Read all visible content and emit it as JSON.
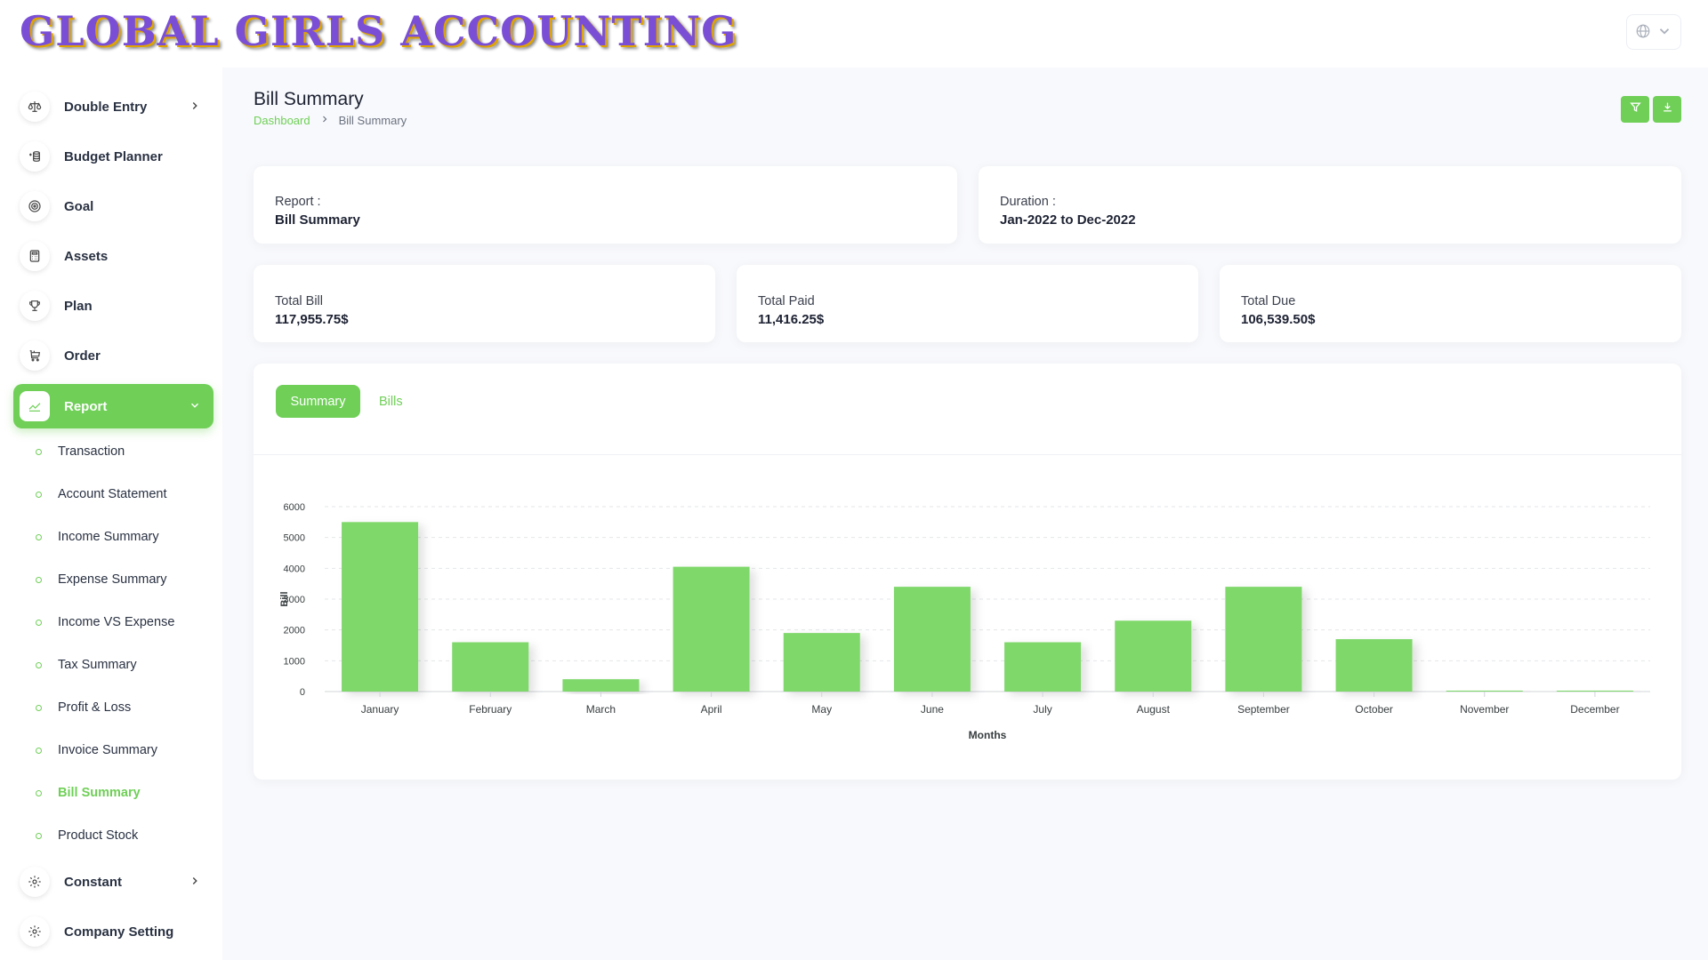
{
  "brand": {
    "logo_text": "GLOBAL GIRLS ACCOUNTING"
  },
  "topbar": {
    "language_icon": "globe-icon"
  },
  "sidebar": {
    "items": [
      {
        "label": "Double Entry",
        "icon": "scale-icon",
        "expandable": true
      },
      {
        "label": "Budget Planner",
        "icon": "money-icon"
      },
      {
        "label": "Goal",
        "icon": "target-icon"
      },
      {
        "label": "Assets",
        "icon": "calculator-icon"
      },
      {
        "label": "Plan",
        "icon": "trophy-icon"
      },
      {
        "label": "Order",
        "icon": "cart-icon"
      },
      {
        "label": "Report",
        "icon": "chart-line-icon",
        "active": true
      },
      {
        "label": "Constant",
        "icon": "gear-icon",
        "expandable": true
      },
      {
        "label": "Company Setting",
        "icon": "gear-icon"
      }
    ],
    "report_subitems": [
      "Transaction",
      "Account Statement",
      "Income Summary",
      "Expense Summary",
      "Income VS Expense",
      "Tax Summary",
      "Profit & Loss",
      "Invoice Summary",
      "Bill Summary",
      "Product Stock"
    ],
    "active_subitem": "Bill Summary"
  },
  "page": {
    "title": "Bill Summary",
    "breadcrumb": {
      "home": "Dashboard",
      "current": "Bill Summary"
    }
  },
  "info": {
    "report_label": "Report :",
    "report_value": "Bill Summary",
    "duration_label": "Duration :",
    "duration_value": "Jan-2022 to Dec-2022"
  },
  "stats": {
    "total_bill_label": "Total Bill",
    "total_bill_value": "117,955.75$",
    "total_paid_label": "Total Paid",
    "total_paid_value": "11,416.25$",
    "total_due_label": "Total Due",
    "total_due_value": "106,539.50$"
  },
  "tabs": {
    "summary": "Summary",
    "bills": "Bills",
    "active": "Summary"
  },
  "colors": {
    "accent": "#6fcf57",
    "bar": "#7ed86a"
  },
  "chart_data": {
    "type": "bar",
    "categories": [
      "January",
      "February",
      "March",
      "April",
      "May",
      "June",
      "July",
      "August",
      "September",
      "October",
      "November",
      "December"
    ],
    "values": [
      5500,
      1600,
      400,
      4050,
      1900,
      3400,
      1600,
      2300,
      3400,
      1700,
      30,
      30
    ],
    "xlabel": "Months",
    "ylabel": "Bill",
    "ylim": [
      0,
      6000
    ],
    "yticks": [
      0,
      1000,
      2000,
      3000,
      4000,
      5000,
      6000
    ],
    "grid": true
  }
}
